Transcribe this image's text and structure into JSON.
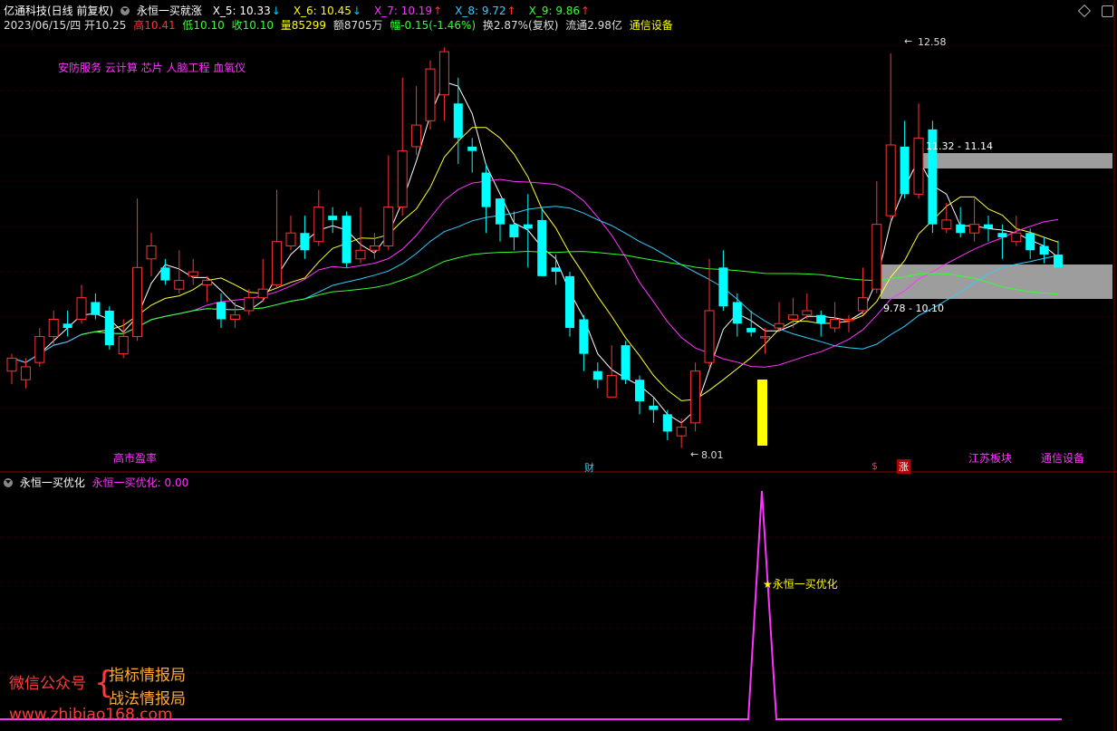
{
  "header": {
    "stock_name": "亿通科技(日线 前复权)",
    "indicator_name": "永恒一买就涨",
    "ma_values": [
      {
        "label": "X_5: 10.33",
        "arrow": "↓",
        "color": "#ffffff",
        "arrow_color": "#00d0ff"
      },
      {
        "label": "X_6: 10.45",
        "arrow": "↓",
        "color": "#ffff00",
        "arrow_color": "#00d0ff"
      },
      {
        "label": "X_7: 10.19",
        "arrow": "↑",
        "color": "#ff33ff",
        "arrow_color": "#ff3333"
      },
      {
        "label": "X_8: 9.72",
        "arrow": "↑",
        "color": "#33ccff",
        "arrow_color": "#ff3333"
      },
      {
        "label": "X_9: 9.86",
        "arrow": "↑",
        "color": "#33ff33",
        "arrow_color": "#ff3333"
      }
    ],
    "quote": {
      "date": "2023/06/15/四",
      "open": "开10.25",
      "high": "高10.41",
      "low": "低10.10",
      "close": "收10.10",
      "volume": "量85299",
      "amount": "额8705万",
      "change": "幅-0.15(-1.46%)",
      "turnover": "换2.87%(复权)",
      "float_cap": "流通2.98亿",
      "sector": "通信设备"
    }
  },
  "concepts": "安防服务 云计算 芯片 人脑工程 血氧仪",
  "annotations": {
    "high_label": "12.58",
    "low_label": "8.01",
    "zone_top": "11.32 - 11.14",
    "zone_bottom": "9.78 - 10.10",
    "gross_margin": "高市盈率",
    "cai": "财",
    "dollar": "$",
    "zhang": "涨",
    "region": "江苏板块",
    "industry": "通信设备"
  },
  "sub_panel": {
    "title": "永恒一买优化",
    "value_label": "永恒一买优化: 0.00",
    "signal_label": "★永恒一买优化"
  },
  "watermark": {
    "wechat": "微信公众号",
    "line1": "指标情报局",
    "line2": "战法情报局",
    "site": "www.zhibiao168.com"
  },
  "colors": {
    "up": "#ff3333",
    "down": "#00ffff",
    "signal": "#ff33ff",
    "volume_bar": "#ffff00"
  },
  "chart_data": {
    "type": "candlestick",
    "price_range": [
      7.9,
      12.8
    ],
    "candles": [
      [
        8.9,
        9.05,
        9.1,
        8.75
      ],
      [
        8.8,
        8.95,
        9.05,
        8.7
      ],
      [
        9.0,
        9.3,
        9.4,
        8.95
      ],
      [
        9.3,
        9.5,
        9.6,
        9.2
      ],
      [
        9.45,
        9.4,
        9.6,
        9.3
      ],
      [
        9.5,
        9.75,
        9.9,
        9.45
      ],
      [
        9.7,
        9.55,
        9.8,
        9.5
      ],
      [
        9.6,
        9.2,
        9.65,
        9.15
      ],
      [
        9.1,
        9.3,
        9.5,
        9.05
      ],
      [
        9.3,
        10.1,
        10.9,
        9.25
      ],
      [
        10.2,
        10.35,
        10.5,
        10.0
      ],
      [
        10.1,
        9.95,
        10.2,
        9.9
      ],
      [
        9.85,
        9.95,
        10.3,
        9.8
      ],
      [
        10.0,
        10.05,
        10.2,
        9.9
      ],
      [
        9.9,
        9.95,
        10.0,
        9.7
      ],
      [
        9.7,
        9.5,
        9.8,
        9.4
      ],
      [
        9.5,
        9.55,
        9.7,
        9.4
      ],
      [
        9.6,
        9.75,
        9.85,
        9.55
      ],
      [
        9.75,
        9.85,
        10.2,
        9.7
      ],
      [
        9.9,
        10.4,
        11.0,
        9.85
      ],
      [
        10.35,
        10.5,
        10.7,
        10.3
      ],
      [
        10.5,
        10.3,
        10.7,
        10.2
      ],
      [
        10.4,
        10.8,
        11.0,
        10.35
      ],
      [
        10.7,
        10.65,
        10.8,
        10.5
      ],
      [
        10.7,
        10.15,
        10.75,
        10.1
      ],
      [
        10.2,
        10.3,
        10.8,
        10.15
      ],
      [
        10.3,
        10.35,
        10.5,
        10.2
      ],
      [
        10.35,
        10.8,
        11.4,
        10.3
      ],
      [
        10.8,
        11.45,
        12.3,
        10.7
      ],
      [
        11.5,
        11.75,
        12.2,
        11.4
      ],
      [
        11.8,
        12.4,
        12.5,
        11.7
      ],
      [
        12.1,
        12.6,
        12.65,
        11.8
      ],
      [
        12.0,
        11.6,
        12.3,
        11.3
      ],
      [
        11.5,
        11.45,
        11.6,
        11.2
      ],
      [
        11.2,
        10.8,
        11.3,
        10.5
      ],
      [
        10.9,
        10.6,
        10.9,
        10.4
      ],
      [
        10.6,
        10.45,
        10.75,
        10.3
      ],
      [
        10.6,
        10.55,
        10.95,
        10.1
      ],
      [
        10.65,
        10.0,
        10.8,
        10.0
      ],
      [
        10.1,
        10.05,
        10.25,
        9.9
      ],
      [
        10.0,
        9.4,
        10.05,
        9.3
      ],
      [
        9.5,
        9.1,
        9.55,
        8.9
      ],
      [
        8.9,
        8.8,
        9.0,
        8.7
      ],
      [
        8.6,
        8.85,
        9.2,
        8.6
      ],
      [
        9.2,
        8.8,
        9.25,
        8.75
      ],
      [
        8.8,
        8.55,
        8.85,
        8.4
      ],
      [
        8.5,
        8.45,
        8.6,
        8.3
      ],
      [
        8.4,
        8.2,
        8.45,
        8.1
      ],
      [
        8.15,
        8.25,
        8.35,
        8.01
      ],
      [
        8.3,
        8.9,
        9.0,
        8.2
      ],
      [
        9.0,
        9.6,
        10.2,
        8.95
      ],
      [
        10.1,
        9.65,
        10.3,
        9.6
      ],
      [
        9.7,
        9.45,
        9.8,
        9.3
      ],
      [
        9.4,
        9.35,
        9.6,
        9.3
      ],
      [
        9.3,
        9.3,
        9.4,
        9.1
      ],
      [
        9.4,
        9.45,
        9.7,
        9.35
      ],
      [
        9.5,
        9.55,
        9.75,
        9.4
      ],
      [
        9.55,
        9.6,
        9.8,
        9.5
      ],
      [
        9.55,
        9.45,
        9.6,
        9.3
      ],
      [
        9.4,
        9.5,
        9.7,
        9.35
      ],
      [
        9.5,
        9.5,
        9.55,
        9.35
      ],
      [
        9.6,
        9.75,
        10.1,
        9.55
      ],
      [
        9.85,
        10.6,
        11.1,
        9.8
      ],
      [
        10.7,
        11.52,
        12.58,
        10.65
      ],
      [
        11.5,
        10.95,
        11.8,
        10.9
      ],
      [
        10.95,
        11.6,
        12.0,
        10.9
      ],
      [
        11.7,
        10.6,
        11.8,
        10.5
      ],
      [
        10.55,
        10.65,
        10.85,
        10.5
      ],
      [
        10.6,
        10.5,
        10.8,
        10.45
      ],
      [
        10.5,
        10.6,
        10.9,
        10.4
      ],
      [
        10.6,
        10.55,
        10.7,
        10.4
      ],
      [
        10.5,
        10.45,
        10.6,
        10.2
      ],
      [
        10.4,
        10.5,
        10.7,
        10.35
      ],
      [
        10.5,
        10.3,
        10.55,
        10.2
      ],
      [
        10.35,
        10.25,
        10.45,
        10.15
      ],
      [
        10.25,
        10.1,
        10.41,
        10.1
      ]
    ],
    "volume_highlight_index": 51
  }
}
